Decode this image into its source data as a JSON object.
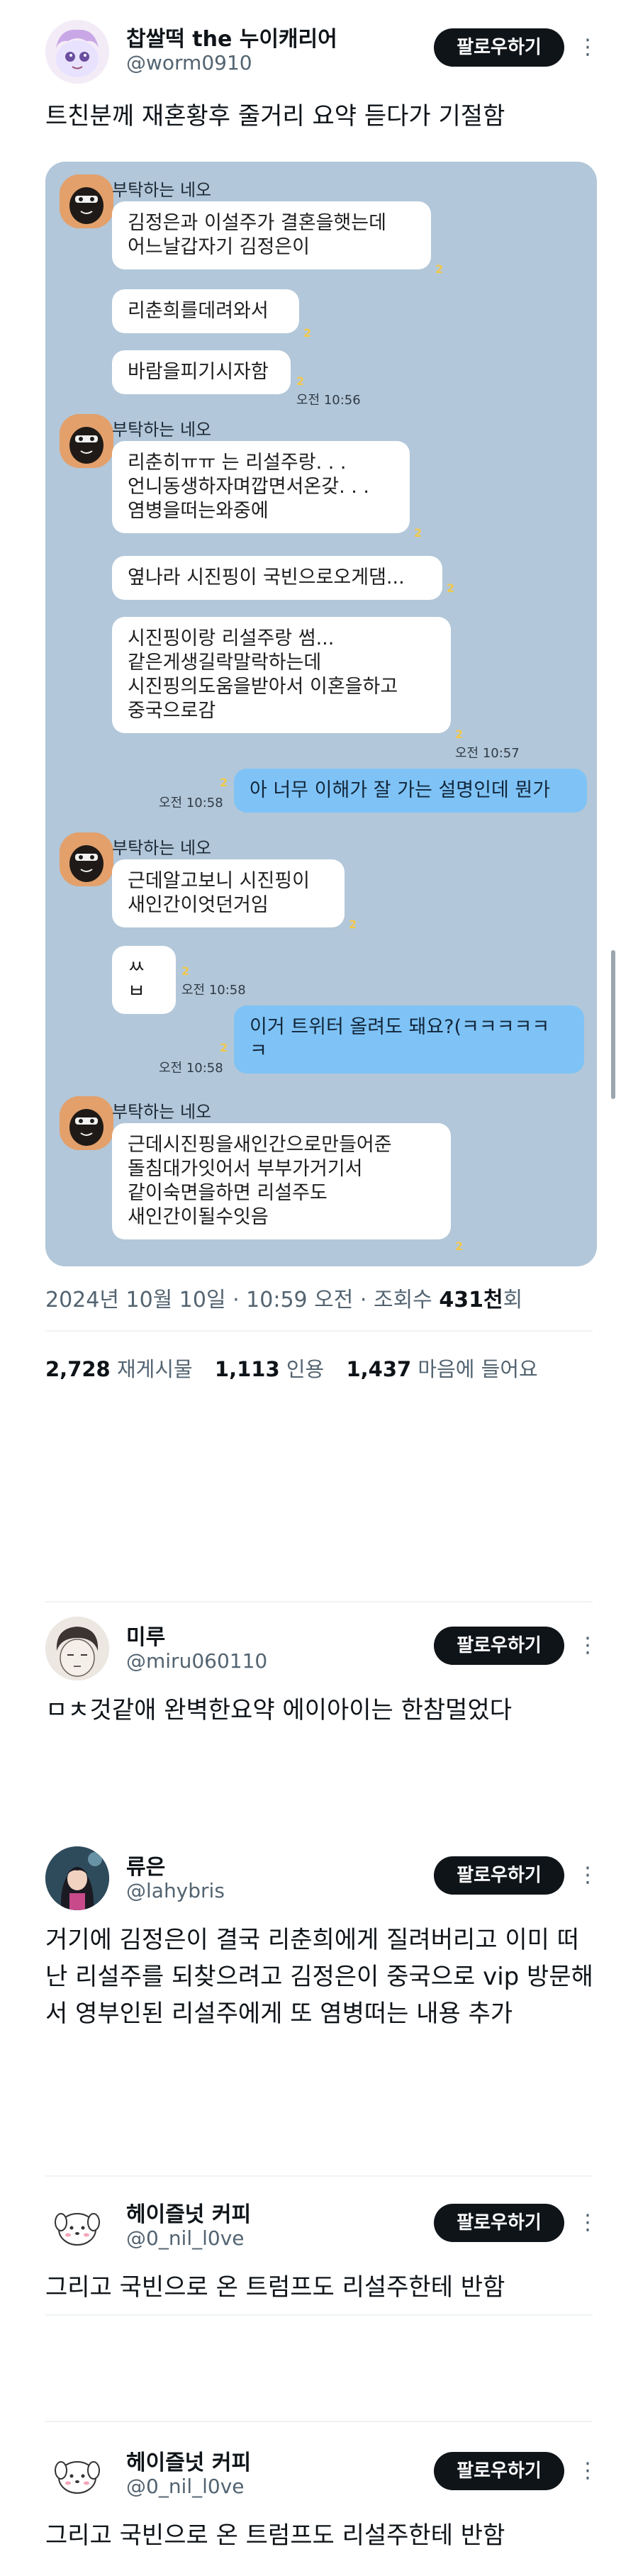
{
  "main_post": {
    "name": "찹쌀떡 the 누이캐리어",
    "handle": "@worm0910",
    "follow_label": "팔로우하기",
    "more_icon": "⋮",
    "text": "트친분께 재혼황후 줄거리 요약 듣다가 기절함",
    "date_line": "2024년 10월 10일 · 10:59 오전 · 조회수",
    "views_count": "431천",
    "views_suffix": "회",
    "retweets_count": "2,728",
    "retweets_label": "재게시물",
    "quotes_count": "1,113",
    "quotes_label": "인용",
    "likes_count": "1,437",
    "likes_label": "마음에 들어요"
  },
  "chat": {
    "sender": "부탁하는 네오",
    "unread_mark": "2",
    "messages": {
      "m1": "김정은과 이설주가 결혼을햇는데\n어느날갑자기 김정은이",
      "m2": "리춘희를데려와서",
      "m3": "바람을피기시자함",
      "t1": "오전 10:56",
      "m4": "리춘히ㅠㅠ 는 리설주랑. . .\n언니동생하자며깝면서온갖. . .\n염병을떠는와중에",
      "m5": "옆나라 시진핑이 국빈으로오게댐...",
      "m6": "시진핑이랑 리설주랑 썸...\n같은게생길락말락하는데\n시진핑의도움을받아서 이혼을하고\n중국으로감",
      "t2": "오전 10:57",
      "r1": "아 너무 이해가 잘 가는 설명인데 뭔가",
      "t3": "오전 10:58",
      "m7": "근데알고보니 시진핑이\n새인간이엇던거임",
      "m8": "ㅆㅂ",
      "t4": "오전 10:58",
      "r2": "이거 트위터 올려도 돼요?(ㅋㅋㅋㅋㅋ\nㅋ",
      "t5": "오전 10:58",
      "m9": "근데시진핑을새인간으로만들어준\n돌침대가잇어서 부부가거기서\n같이숙면을하면 리설주도\n새인간이될수잇음"
    }
  },
  "replies": [
    {
      "name": "미루",
      "handle": "@miru060110",
      "follow_label": "팔로우하기",
      "more_icon": "⋮",
      "text": "ㅁㅊ것같애 완벽한요약 에이아이는 한참멀었다"
    },
    {
      "name": "류은",
      "handle": "@lahybris",
      "follow_label": "팔로우하기",
      "more_icon": "⋮",
      "text": "거기에 김정은이 결국 리춘희에게 질려버리고 이미 떠난 리설주를 되찾으려고 김정은이 중국으로 vip 방문해서 영부인된 리설주에게 또 염병떠는 내용 추가"
    },
    {
      "name": "헤이즐넛 커피",
      "handle": "@0_nil_l0ve",
      "follow_label": "팔로우하기",
      "more_icon": "⋮",
      "text": "그리고 국빈으로 온 트럼프도 리설주한테 반함"
    },
    {
      "name": "헤이즐넛 커피",
      "handle": "@0_nil_l0ve",
      "follow_label": "팔로우하기",
      "more_icon": "⋮",
      "text": "그리고 국빈으로 온 트럼프도 리설주한테 반함"
    }
  ]
}
